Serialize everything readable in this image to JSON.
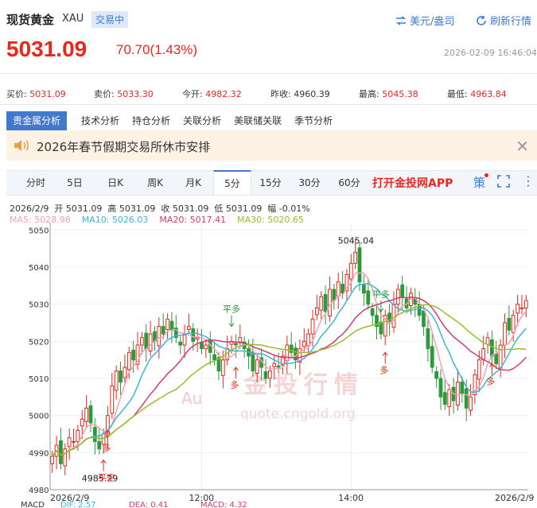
{
  "header": {
    "title": "现货黄金",
    "code": "XAU",
    "status": "交易中",
    "unit_label": "美元/盎司",
    "refresh_label": "刷新行情"
  },
  "quote": {
    "price": "5031.09",
    "change": "70.70(1.43%)",
    "datetime": "2026-02-09 16:46:04",
    "bid_label": "买价:",
    "bid": "5031.09",
    "ask_label": "卖价:",
    "ask": "5033.30",
    "open_label": "今开:",
    "open": "4982.32",
    "prev_label": "昨收:",
    "prev": "4960.39",
    "high_label": "最高:",
    "high": "5045.38",
    "low_label": "最低:",
    "low": "4963.84"
  },
  "analysis_tabs": [
    "贵金属分析",
    "技术分析",
    "持仓分析",
    "关联分析",
    "美联储关联",
    "季节分析"
  ],
  "notice": {
    "text": "2026年春节假期交易所休市安排"
  },
  "period_tabs": [
    "分时",
    "5日",
    "日K",
    "周K",
    "月K",
    "5分",
    "15分",
    "30分",
    "60分"
  ],
  "active_period": "5分",
  "app_link": "打开金投网APP",
  "strategy_label": "策",
  "info_line": "2026/2/9  开 5031.09  高 5031.09  收 5031.09  低 5031.09  幅 -0.01%",
  "ma": [
    {
      "label": "MA5: 5028.98",
      "color": "#f4a0b4"
    },
    {
      "label": "MA10: 5026.03",
      "color": "#3cb4dc"
    },
    {
      "label": "MA20: 5017.41",
      "color": "#d23c6e"
    },
    {
      "label": "MA30: 5020.65",
      "color": "#96be28"
    }
  ],
  "watermark": {
    "text": "金投行情",
    "sub": "quote.cngold.org"
  },
  "macd_line": [
    "MACD",
    "DIF: 2.57",
    "DEA: 0.41",
    "MACD: 4.32"
  ],
  "chart_data": {
    "type": "candlestick",
    "ylim": [
      4980,
      5052
    ],
    "y_ticks": [
      4980,
      4990,
      5000,
      5010,
      5020,
      5030,
      5040,
      5050
    ],
    "x_ticks": [
      "2026/2/9",
      "12:00",
      "14:00",
      "2026/2/9"
    ],
    "annotations": [
      {
        "text": "5045.04",
        "index": 71,
        "value": 5045.04,
        "pos": "above"
      },
      {
        "text": "4985.29",
        "index": 11,
        "value": 4985.29,
        "pos": "below"
      }
    ],
    "signals": [
      {
        "text": "平空",
        "index": 12,
        "value": 4988,
        "dir": "up",
        "color": "#e8281d"
      },
      {
        "text": "多",
        "index": 13,
        "value": 4996,
        "dir": "up",
        "color": "#e8281d"
      },
      {
        "text": "平多",
        "index": 42,
        "value": 5024,
        "dir": "down",
        "color": "#2a9a3a"
      },
      {
        "text": "多",
        "index": 43,
        "value": 5013,
        "dir": "up",
        "color": "#e8281d"
      },
      {
        "text": "平多",
        "index": 77,
        "value": 5028,
        "dir": "down",
        "color": "#2a9a3a"
      },
      {
        "text": "多",
        "index": 78,
        "value": 5017,
        "dir": "up",
        "color": "#e8281d"
      },
      {
        "text": "多",
        "index": 103,
        "value": 5014,
        "dir": "up",
        "color": "#e8281d"
      }
    ],
    "closes": [
      4989,
      4992,
      4987,
      4991,
      4994,
      4993,
      4996,
      4999,
      5002,
      4998,
      4993,
      4991,
      4995,
      5000,
      5008,
      5012,
      5009,
      5013,
      5017,
      5015,
      5019,
      5021,
      5018,
      5022,
      5020,
      5024,
      5022,
      5026,
      5023,
      5021,
      5019,
      5022,
      5024,
      5020,
      5021,
      5018,
      5019,
      5017,
      5015,
      5012,
      5015,
      5018,
      5020,
      5019,
      5021,
      5018,
      5016,
      5012,
      5015,
      5013,
      5010,
      5012,
      5014,
      5013,
      5016,
      5019,
      5017,
      5015,
      5018,
      5020,
      5022,
      5026,
      5029,
      5032,
      5028,
      5034,
      5031,
      5036,
      5033,
      5038,
      5041,
      5044,
      5036,
      5033,
      5030,
      5027,
      5024,
      5022,
      5027,
      5025,
      5030,
      5034,
      5032,
      5029,
      5033,
      5030,
      5027,
      5024,
      5018,
      5013,
      5010,
      5005,
      5003,
      5007,
      5004,
      5009,
      5006,
      5002,
      5005,
      5011,
      5015,
      5018,
      5021,
      5016,
      5014,
      5019,
      5025,
      5023,
      5027,
      5030,
      5029,
      5031
    ],
    "ma5_last": 5028.98,
    "ma10_last": 5026.03,
    "ma20_last": 5017.41,
    "ma30_last": 5020.65
  }
}
